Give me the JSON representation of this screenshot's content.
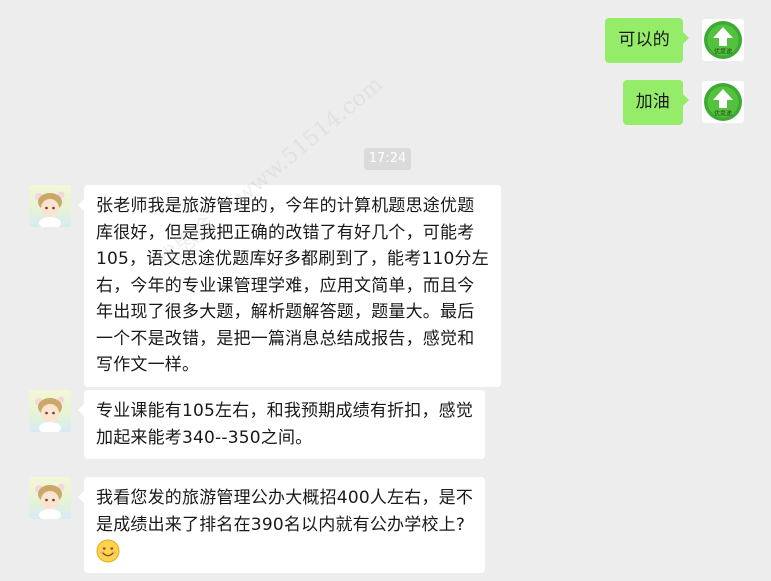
{
  "timestamp": "17:24",
  "self_messages": [
    {
      "text": "可以的"
    },
    {
      "text": "加油"
    }
  ],
  "self_avatar": {
    "icon": "green-upload-arrow-icon",
    "caption": "优思途"
  },
  "incoming_messages": [
    {
      "lines": [
        "张老师我是旅游管理的，今年的计算机题思途优题",
        "库很好，但是我把正确的改错了有好几个，可能考",
        "105，语文思途优题库好多都刷到了，能考110分左",
        "右，今年的专业课管理学难，应用文简单，而且今",
        "年出现了很多大题，解析题解答题，题量大。最后",
        "一个不是改错，是把一篇消息总结成报告，感觉和",
        "写作文一样。"
      ]
    },
    {
      "lines": [
        "专业课能有105左右，和我预期成绩有折扣，感觉",
        "加起来能考340--350之间。"
      ]
    },
    {
      "lines": [
        "我看您发的旅游管理公办大概招400人左右，是不",
        "是成绩出来了排名在390名以内就有公办学校上?"
      ],
      "emoji": "smile-emoji-icon"
    }
  ],
  "watermark": {
    "brand": "优思途",
    "site": "www.51514.com"
  }
}
